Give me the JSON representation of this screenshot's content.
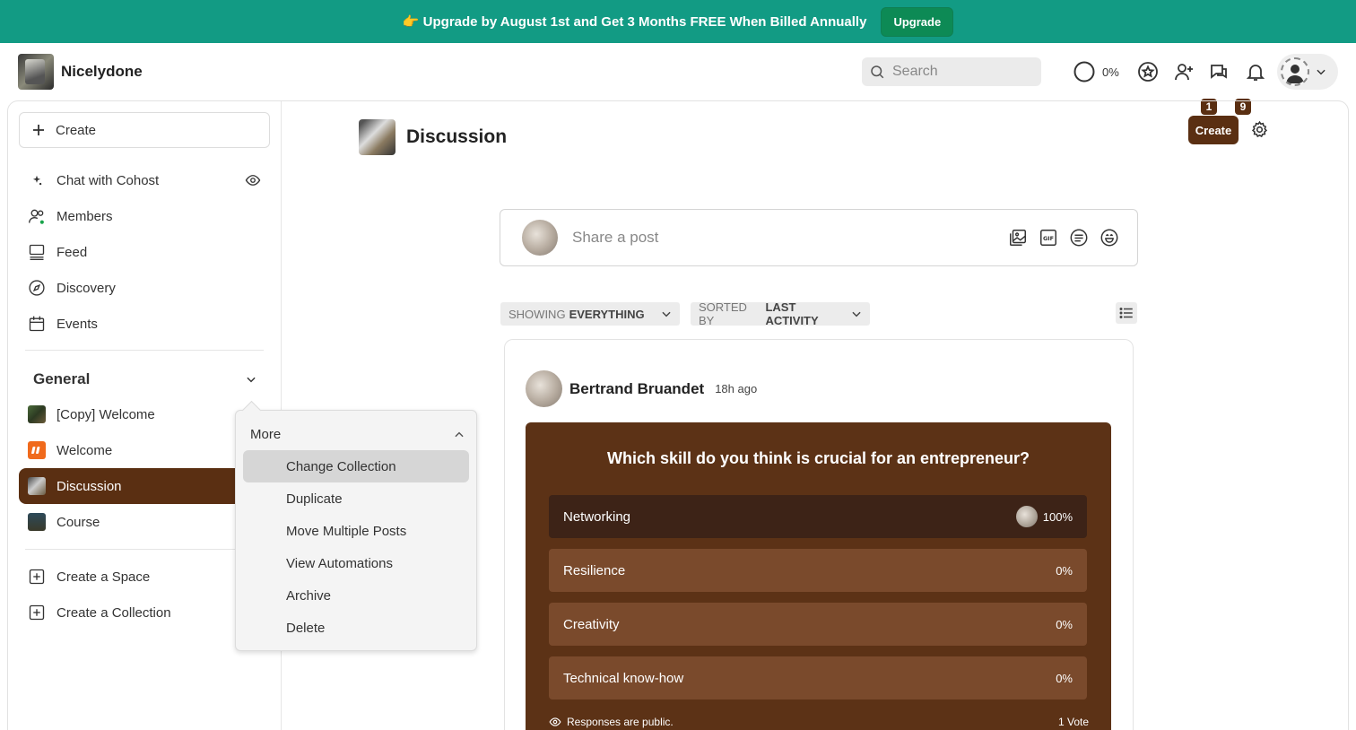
{
  "banner": {
    "text": "👉 Upgrade by August 1st and Get 3 Months FREE When Billed Annually",
    "button": "Upgrade"
  },
  "header": {
    "brand": "Nicelydone",
    "search_placeholder": "Search",
    "progress_text": "0%",
    "chat_badge": "1",
    "notif_badge": "9",
    "icons": [
      "star-icon",
      "add-user-icon",
      "chat-icon",
      "bell-icon",
      "chevron-down-icon"
    ]
  },
  "sidebar": {
    "create": "Create",
    "items": [
      {
        "label": "Chat with Cohost",
        "icon": "sparkle-icon"
      },
      {
        "label": "Members",
        "icon": "users-icon"
      },
      {
        "label": "Feed",
        "icon": "feed-icon"
      },
      {
        "label": "Discovery",
        "icon": "compass-icon"
      },
      {
        "label": "Events",
        "icon": "calendar-icon"
      }
    ],
    "group": "General",
    "spaces": [
      {
        "label": "[Copy] Welcome"
      },
      {
        "label": "Welcome"
      },
      {
        "label": "Discussion"
      },
      {
        "label": "Course"
      }
    ],
    "create_space": "Create a Space",
    "create_collection": "Create a Collection"
  },
  "dropdown": {
    "header": "More",
    "items": [
      "Change Collection",
      "Duplicate",
      "Move Multiple Posts",
      "View Automations",
      "Archive",
      "Delete"
    ]
  },
  "page": {
    "title": "Discussion",
    "create": "Create",
    "composer_placeholder": "Share a post",
    "filter_showing_prefix": "SHOWING",
    "filter_showing_value": "EVERYTHING",
    "filter_sort_prefix": "SORTED BY",
    "filter_sort_value": "LAST ACTIVITY"
  },
  "post": {
    "author": "Bertrand Bruandet",
    "time": "18h ago",
    "poll": {
      "question": "Which skill do you think is crucial for an entrepreneur?",
      "options": [
        {
          "label": "Networking",
          "percent": "100%"
        },
        {
          "label": "Resilience",
          "percent": "0%"
        },
        {
          "label": "Creativity",
          "percent": "0%"
        },
        {
          "label": "Technical know-how",
          "percent": "0%"
        }
      ],
      "footer_left": "Responses are public.",
      "footer_right": "1 Vote"
    }
  },
  "colors": {
    "banner": "#129b84",
    "accent": "#5a2f12",
    "poll_bg": "#5c3216"
  }
}
